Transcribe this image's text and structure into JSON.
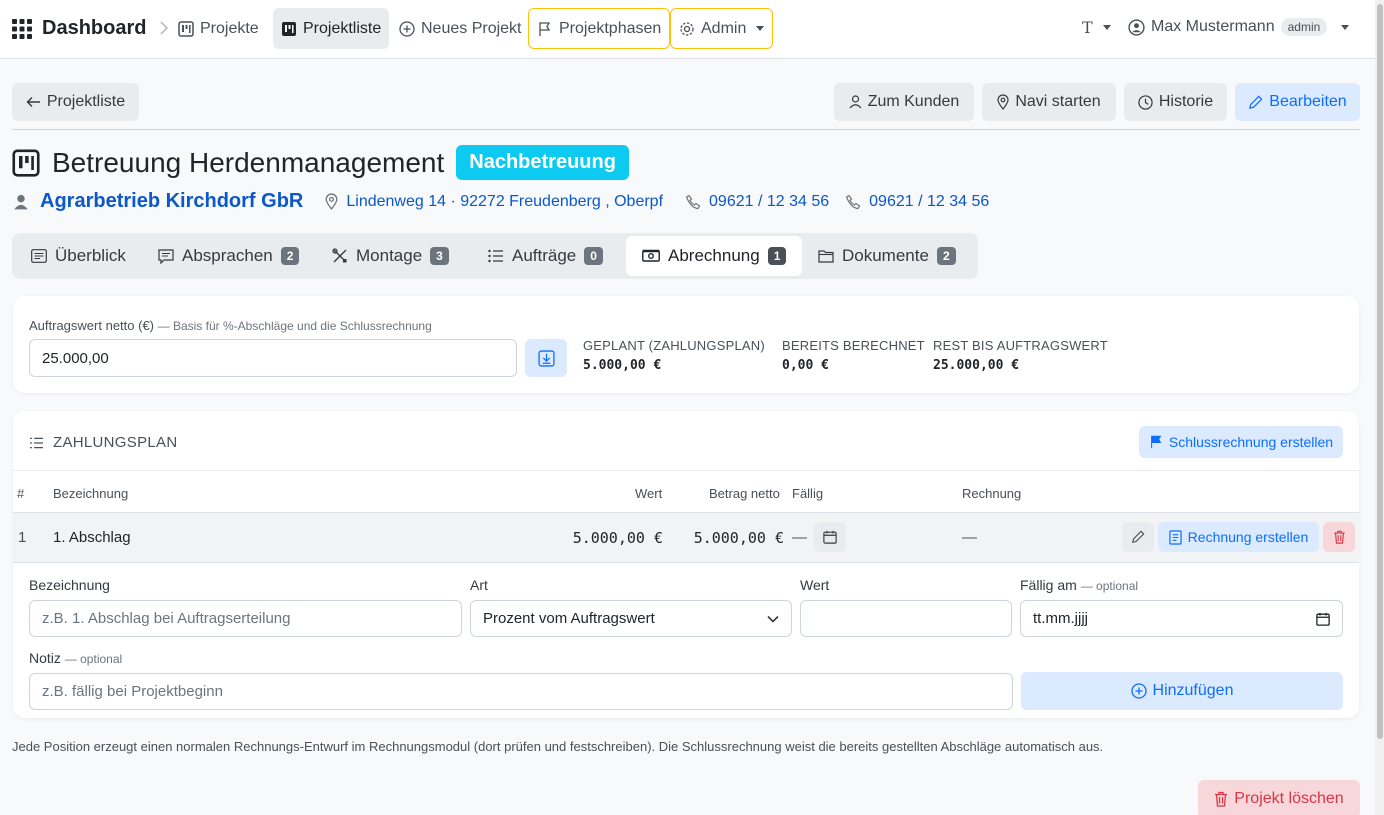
{
  "nav": {
    "brand": "Dashboard",
    "items": [
      {
        "label": "Projekte"
      },
      {
        "label": "Projektliste"
      },
      {
        "label": "Neues Projekt"
      },
      {
        "label": "Projektphasen"
      },
      {
        "label": "Admin"
      }
    ],
    "font_switch": "T",
    "user_name": "Max Mustermann",
    "user_role": "admin"
  },
  "actions": {
    "back": "Projektliste",
    "to_customer": "Zum Kunden",
    "navigate": "Navi starten",
    "history": "Historie",
    "edit": "Bearbeiten"
  },
  "project": {
    "title": "Betreuung Herdenmanagement",
    "phase": "Nachbetreuung",
    "customer": "Agrarbetrieb Kirchdorf GbR",
    "address": "Lindenweg 14 · 92272 Freudenberg , Oberpf",
    "phone1": "09621 / 12 34 56",
    "phone2": "09621 / 12 34 56"
  },
  "tabs": [
    {
      "label": "Überblick",
      "count": null
    },
    {
      "label": "Absprachen",
      "count": "2"
    },
    {
      "label": "Montage",
      "count": "3"
    },
    {
      "label": "Aufträge",
      "count": "0"
    },
    {
      "label": "Abrechnung",
      "count": "1"
    },
    {
      "label": "Dokumente",
      "count": "2"
    }
  ],
  "summary": {
    "order_value_label": "Auftragswert netto (€)",
    "order_value_hint": "— Basis für %-Abschläge und die Schlussrechnung",
    "order_value": "25.000,00",
    "planned_label": "GEPLANT (ZAHLUNGSPLAN)",
    "planned_value": "5.000,00 €",
    "billed_label": "BEREITS BERECHNET",
    "billed_value": "0,00 €",
    "rest_label": "REST BIS AUFTRAGSWERT",
    "rest_value": "25.000,00 €"
  },
  "plan": {
    "title": "ZAHLUNGSPLAN",
    "final_invoice_button": "Schlussrechnung erstellen",
    "columns": {
      "num": "#",
      "name": "Bezeichnung",
      "value": "Wert",
      "amount": "Betrag netto",
      "due": "Fällig",
      "invoice": "Rechnung"
    },
    "rows": [
      {
        "num": "1",
        "name": "1. Abschlag",
        "value": "5.000,00 €",
        "amount": "5.000,00 €",
        "due": "—",
        "invoice": "—",
        "create_invoice": "Rechnung erstellen"
      }
    ]
  },
  "form": {
    "name_label": "Bezeichnung",
    "name_placeholder": "z.B. 1. Abschlag bei Auftragserteilung",
    "type_label": "Art",
    "type_value": "Prozent vom Auftragswert",
    "value_label": "Wert",
    "due_label": "Fällig am",
    "due_optional": "— optional",
    "due_placeholder": "tt.mm.jjjj",
    "note_label": "Notiz",
    "note_optional": "— optional",
    "note_placeholder": "z.B. fällig bei Projektbeginn",
    "add_button": "Hinzufügen"
  },
  "footer_note": "Jede Position erzeugt einen normalen Rechnungs-Entwurf im Rechnungsmodul (dort prüfen und festschreiben). Die Schlussrechnung weist die bereits gestellten Abschläge automatisch aus.",
  "delete_project": "Projekt löschen",
  "colors": {
    "primary": "#0d6efd",
    "info": "#0dcaf0",
    "danger": "#dc3545",
    "warning": "#ffc107"
  }
}
